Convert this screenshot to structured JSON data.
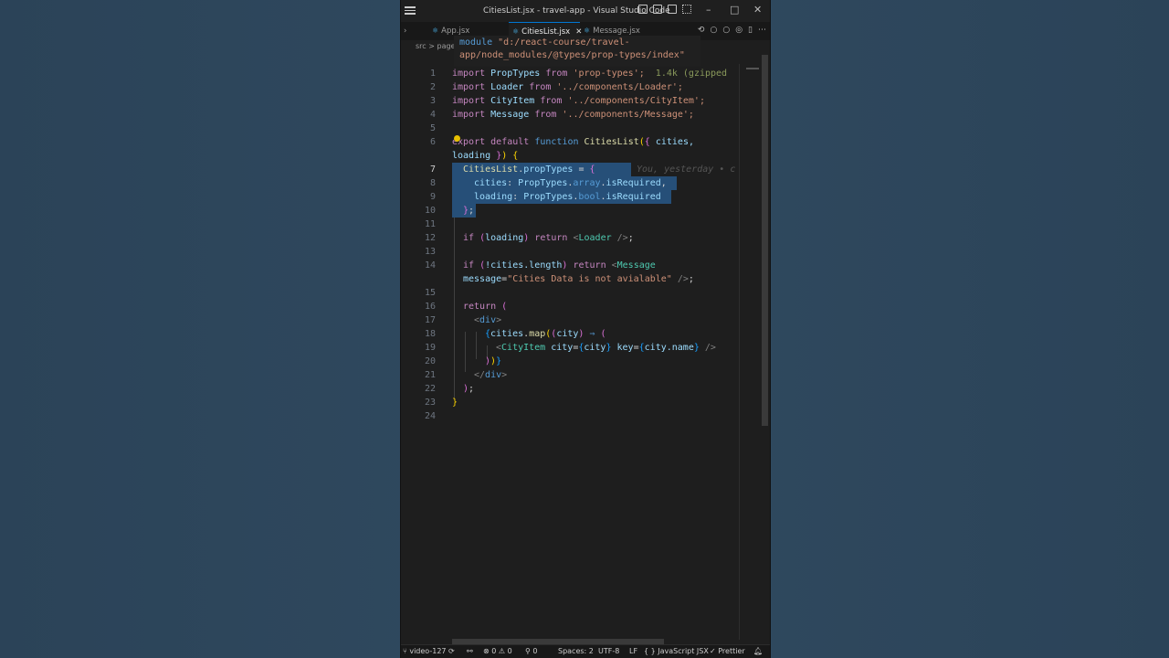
{
  "window": {
    "title": "CitiesList.jsx - travel-app - Visual Studio Code"
  },
  "tabs": [
    {
      "label": "App.jsx"
    },
    {
      "label": "CitiesList.jsx"
    },
    {
      "label": "Message.jsx"
    }
  ],
  "breadcrumb": {
    "src": "src",
    "sep": ">",
    "pages": "pages"
  },
  "hover": {
    "kw": "module",
    "path_line1": "\"d:/react-course/travel-",
    "path_line2": "app/node_modules/@types/prop-types/index\""
  },
  "code": {
    "import_size": "1.4k (gzipped",
    "blame": "You, yesterday • c",
    "lines": {
      "l1": [
        "import",
        " PropTypes ",
        "from",
        " 'prop-types';"
      ],
      "l2": [
        "import",
        " Loader ",
        "from",
        " '../components/Loader';"
      ],
      "l3": [
        "import",
        " CityItem ",
        "from",
        " '../components/CityItem';"
      ],
      "l4": [
        "import",
        " Message ",
        "from",
        " '../components/Message';"
      ],
      "l6": [
        "export",
        " ",
        "default",
        " ",
        "function",
        " ",
        "CitiesList",
        "(",
        "{",
        " cities,"
      ],
      "l6b": [
        "loading",
        " ",
        "}",
        ")",
        " {"
      ],
      "l7": [
        "CitiesList",
        ".",
        "propTypes",
        " = ",
        "{"
      ],
      "l8": [
        "cities",
        ": ",
        "PropTypes",
        ".",
        "array",
        ".",
        "isRequired",
        ","
      ],
      "l9": [
        "loading",
        ": ",
        "PropTypes",
        ".",
        "bool",
        ".",
        "isRequired"
      ],
      "l10": [
        "}",
        ";"
      ],
      "l12": [
        "if",
        " ",
        "(",
        "loading",
        ")",
        " ",
        "return",
        " <",
        "Loader",
        " />",
        ";"
      ],
      "l14": [
        "if",
        " ",
        "(",
        "!cities.length",
        ")",
        " ",
        "return",
        " <",
        "Message"
      ],
      "l14b": [
        "message",
        "=",
        "\"Cities Data is not avialable\"",
        " />",
        ";"
      ],
      "l16": [
        "return",
        " ",
        "("
      ],
      "l17": [
        "<",
        "div",
        ">"
      ],
      "l18": [
        "{",
        "cities",
        ".",
        "map",
        "(",
        "(",
        "city",
        ")",
        " ⇒ ",
        "("
      ],
      "l19": [
        "<",
        "CityItem",
        " city",
        "=",
        "{",
        "city",
        "}",
        " key",
        "=",
        "{",
        "city.name",
        "}",
        " />"
      ],
      "l20": [
        ")",
        ")",
        "}"
      ],
      "l21": [
        "</",
        "div",
        ">"
      ],
      "l22": [
        ")",
        ";"
      ],
      "l23": [
        "}"
      ]
    },
    "numbers": {
      "n1": "1",
      "n2": "2",
      "n3": "3",
      "n4": "4",
      "n5": "5",
      "n6": "6",
      "n7": "7",
      "n8": "8",
      "n9": "9",
      "n10": "10",
      "n11": "11",
      "n12": "12",
      "n13": "13",
      "n14": "14",
      "n15": "15",
      "n16": "16",
      "n17": "17",
      "n18": "18",
      "n19": "19",
      "n20": "20",
      "n21": "21",
      "n22": "22",
      "n23": "23",
      "n24": "24"
    }
  },
  "status": {
    "branch": "video-127",
    "errors": "0",
    "warnings": "0",
    "ports": "0",
    "spaces": "Spaces: 2",
    "encoding": "UTF-8",
    "eol": "LF",
    "language": "JavaScript JSX",
    "formatter": "Prettier"
  },
  "colors": {
    "accent": "#0078d4",
    "selection": "#264f78",
    "background": "#2a4257"
  }
}
